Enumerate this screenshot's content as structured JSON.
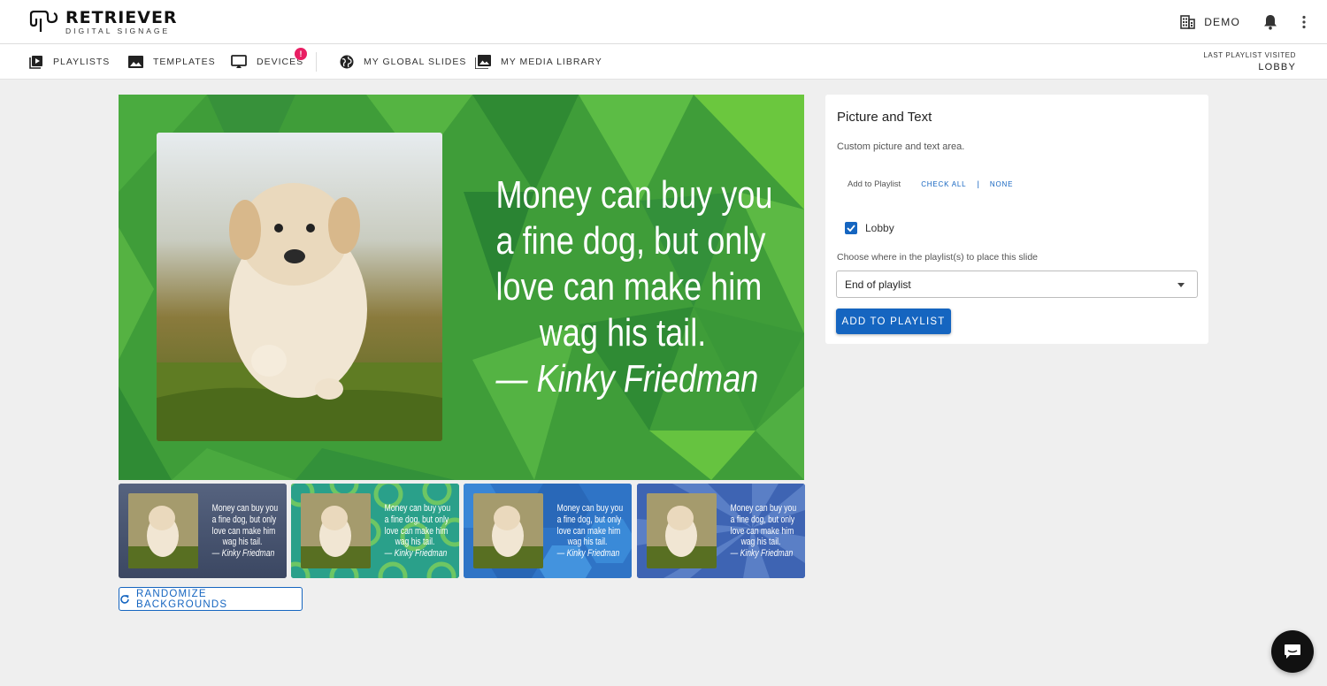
{
  "brand": {
    "title": "RETRIEVER",
    "subtitle": "DIGITAL SIGNAGE"
  },
  "header": {
    "org_label": "DEMO"
  },
  "nav": {
    "items": [
      {
        "label": "PLAYLISTS",
        "icon": "play-box-icon"
      },
      {
        "label": "TEMPLATES",
        "icon": "image-icon"
      },
      {
        "label": "DEVICES",
        "icon": "monitor-icon",
        "badge": "!"
      },
      {
        "label": "MY GLOBAL SLIDES",
        "icon": "globe-icon"
      },
      {
        "label": "MY MEDIA LIBRARY",
        "icon": "images-icon"
      }
    ],
    "last_visited_label": "LAST PLAYLIST VISITED",
    "last_visited_value": "LOBBY"
  },
  "slide": {
    "quote_lines": [
      "Money can buy you",
      "a fine dog, but only",
      "love can make him",
      "wag his tail."
    ],
    "author": "— Kinky Friedman",
    "background_color": "#3f9d39"
  },
  "thumbnails": [
    {
      "name": "slate",
      "color": "#4a5778"
    },
    {
      "name": "teal-circles",
      "color": "#2aa08a"
    },
    {
      "name": "blue-hexagons",
      "color": "#2f74c6"
    },
    {
      "name": "blue-rays",
      "color": "#3e64b3"
    }
  ],
  "randomize_label": "RANDOMIZE BACKGROUNDS",
  "panel": {
    "title": "Picture and Text",
    "description": "Custom picture and text area.",
    "add_to_playlist_label": "Add to Playlist",
    "check_all": "CHECK ALL",
    "separator": "|",
    "none": "NONE",
    "playlists": [
      {
        "label": "Lobby",
        "checked": true
      }
    ],
    "position_label": "Choose where in the playlist(s) to place this slide",
    "position_value": "End of playlist",
    "submit_label": "ADD TO PLAYLIST"
  },
  "colors": {
    "primary": "#1565c0",
    "badge": "#e91e63"
  }
}
